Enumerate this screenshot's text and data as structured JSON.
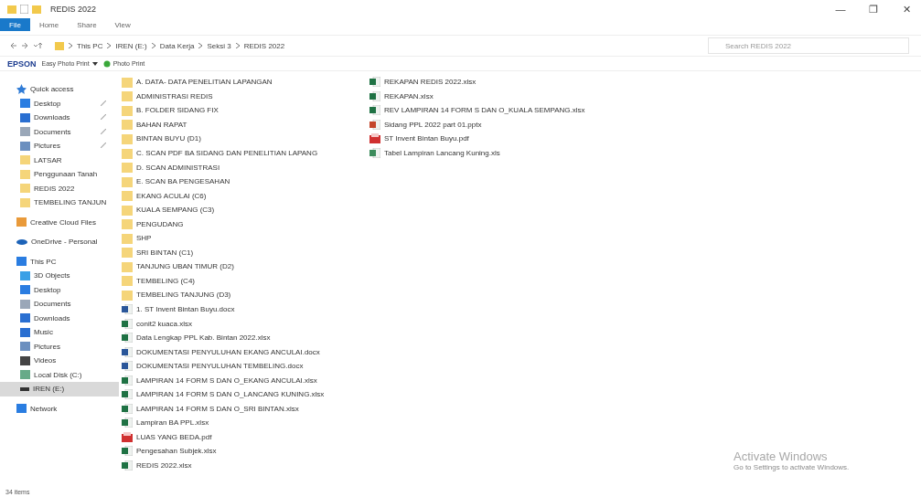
{
  "window": {
    "title": "REDIS 2022",
    "controls": [
      "—",
      "❐",
      "✕"
    ]
  },
  "ribbon_tabs": [
    {
      "label": "File",
      "selected": true
    },
    {
      "label": "Home",
      "selected": false
    },
    {
      "label": "Share",
      "selected": false
    },
    {
      "label": "View",
      "selected": false
    }
  ],
  "address": {
    "crumbs": [
      "This PC",
      "IREN (E:)",
      "Data Kerja",
      "Seksi 3",
      "REDIS 2022"
    ],
    "search_placeholder": "Search REDIS 2022"
  },
  "epson_bar": {
    "brand": "EPSON",
    "items": [
      "Easy Photo Print",
      "Photo Print"
    ]
  },
  "sidebar": [
    {
      "label": "Quick access",
      "kind": "star",
      "selected": false,
      "children": [
        {
          "label": "Desktop",
          "kind": "desktop",
          "pinned": true,
          "selected": false
        },
        {
          "label": "Downloads",
          "kind": "download",
          "pinned": true,
          "selected": false
        },
        {
          "label": "Documents",
          "kind": "document",
          "pinned": true,
          "selected": false
        },
        {
          "label": "Pictures",
          "kind": "pictures",
          "pinned": true,
          "selected": false
        },
        {
          "label": "LATSAR",
          "kind": "folder",
          "pinned": false,
          "selected": false
        },
        {
          "label": "Penggunaan Tanah",
          "kind": "folder",
          "pinned": false,
          "selected": false
        },
        {
          "label": "REDIS 2022",
          "kind": "folder",
          "pinned": false,
          "selected": false
        },
        {
          "label": "TEMBELING TANJUN",
          "kind": "folder",
          "pinned": false,
          "selected": false
        }
      ]
    },
    {
      "label": "Creative Cloud Files",
      "kind": "cloudfolder",
      "selected": false
    },
    {
      "label": "OneDrive - Personal",
      "kind": "cloud",
      "selected": false
    },
    {
      "label": "This PC",
      "kind": "pc",
      "selected": false,
      "children": [
        {
          "label": "3D Objects",
          "kind": "cube",
          "pinned": false,
          "selected": false
        },
        {
          "label": "Desktop",
          "kind": "desktop",
          "pinned": false,
          "selected": false
        },
        {
          "label": "Documents",
          "kind": "document",
          "pinned": false,
          "selected": false
        },
        {
          "label": "Downloads",
          "kind": "download",
          "pinned": false,
          "selected": false
        },
        {
          "label": "Music",
          "kind": "music",
          "pinned": false,
          "selected": false
        },
        {
          "label": "Pictures",
          "kind": "pictures",
          "pinned": false,
          "selected": false
        },
        {
          "label": "Videos",
          "kind": "video",
          "pinned": false,
          "selected": false
        },
        {
          "label": "Local Disk (C:)",
          "kind": "disk",
          "pinned": false,
          "selected": false
        },
        {
          "label": "IREN (E:)",
          "kind": "drive",
          "pinned": false,
          "selected": true
        }
      ]
    },
    {
      "label": "Network",
      "kind": "network",
      "selected": false
    }
  ],
  "files": [
    {
      "name": "A. DATA- DATA PENELITIAN LAPANGAN",
      "kind": "folder"
    },
    {
      "name": "ADMINISTRASI REDIS",
      "kind": "folder"
    },
    {
      "name": "B. FOLDER SIDANG FIX",
      "kind": "folder"
    },
    {
      "name": "BAHAN RAPAT",
      "kind": "folder"
    },
    {
      "name": "BINTAN BUYU (D1)",
      "kind": "folder"
    },
    {
      "name": "C. SCAN PDF BA SIDANG DAN PENELITIAN LAPANG",
      "kind": "folder"
    },
    {
      "name": "D. SCAN ADMINISTRASI",
      "kind": "folder"
    },
    {
      "name": "E. SCAN BA PENGESAHAN",
      "kind": "folder"
    },
    {
      "name": "EKANG ACULAI (C6)",
      "kind": "folder"
    },
    {
      "name": "KUALA SEMPANG (C3)",
      "kind": "folder"
    },
    {
      "name": "PENGUDANG",
      "kind": "folder"
    },
    {
      "name": "SHP",
      "kind": "folder"
    },
    {
      "name": "SRI BINTAN (C1)",
      "kind": "folder"
    },
    {
      "name": "TANJUNG UBAN TIMUR (D2)",
      "kind": "folder"
    },
    {
      "name": "TEMBELING (C4)",
      "kind": "folder"
    },
    {
      "name": "TEMBELING TANJUNG (D3)",
      "kind": "folder"
    },
    {
      "name": "1. ST Invent Bintan Buyu.docx",
      "kind": "word"
    },
    {
      "name": "conit2 kuaca.xlsx",
      "kind": "excel"
    },
    {
      "name": "Data Lengkap PPL Kab. Bintan 2022.xlsx",
      "kind": "excel"
    },
    {
      "name": "DOKUMENTASI PENYULUHAN EKANG ANCULAI.docx",
      "kind": "word"
    },
    {
      "name": "DOKUMENTASI PENYULUHAN TEMBELING.docx",
      "kind": "word"
    },
    {
      "name": "LAMPIRAN 14 FORM S DAN O_EKANG ANCULAI.xlsx",
      "kind": "excel"
    },
    {
      "name": "LAMPIRAN 14 FORM S DAN O_LANCANG KUNING.xlsx",
      "kind": "excel"
    },
    {
      "name": "LAMPIRAN 14 FORM S DAN O_SRI BINTAN.xlsx",
      "kind": "excel"
    },
    {
      "name": "Lampiran BA PPL.xlsx",
      "kind": "excel"
    },
    {
      "name": "LUAS YANG BEDA.pdf",
      "kind": "pdf"
    },
    {
      "name": "Pengesahan Subjek.xlsx",
      "kind": "excel"
    },
    {
      "name": "REDIS 2022.xlsx",
      "kind": "excel"
    },
    {
      "name": "REKAPAN REDIS 2022.xlsx",
      "kind": "excel"
    },
    {
      "name": "REKAPAN.xlsx",
      "kind": "excel"
    },
    {
      "name": "REV LAMPIRAN 14 FORM S DAN O_KUALA SEMPANG.xlsx",
      "kind": "excel"
    },
    {
      "name": "Sidang PPL 2022 part 01.pptx",
      "kind": "ppt"
    },
    {
      "name": "ST Invent Bintan Buyu.pdf",
      "kind": "pdf"
    },
    {
      "name": "Tabel Lampiran Lancang Kuning.xls",
      "kind": "excel_old"
    }
  ],
  "status_bar": {
    "count": "34 items"
  },
  "activation_notice": {
    "title": "Activate Windows",
    "text": "Go to Settings to activate Windows."
  }
}
